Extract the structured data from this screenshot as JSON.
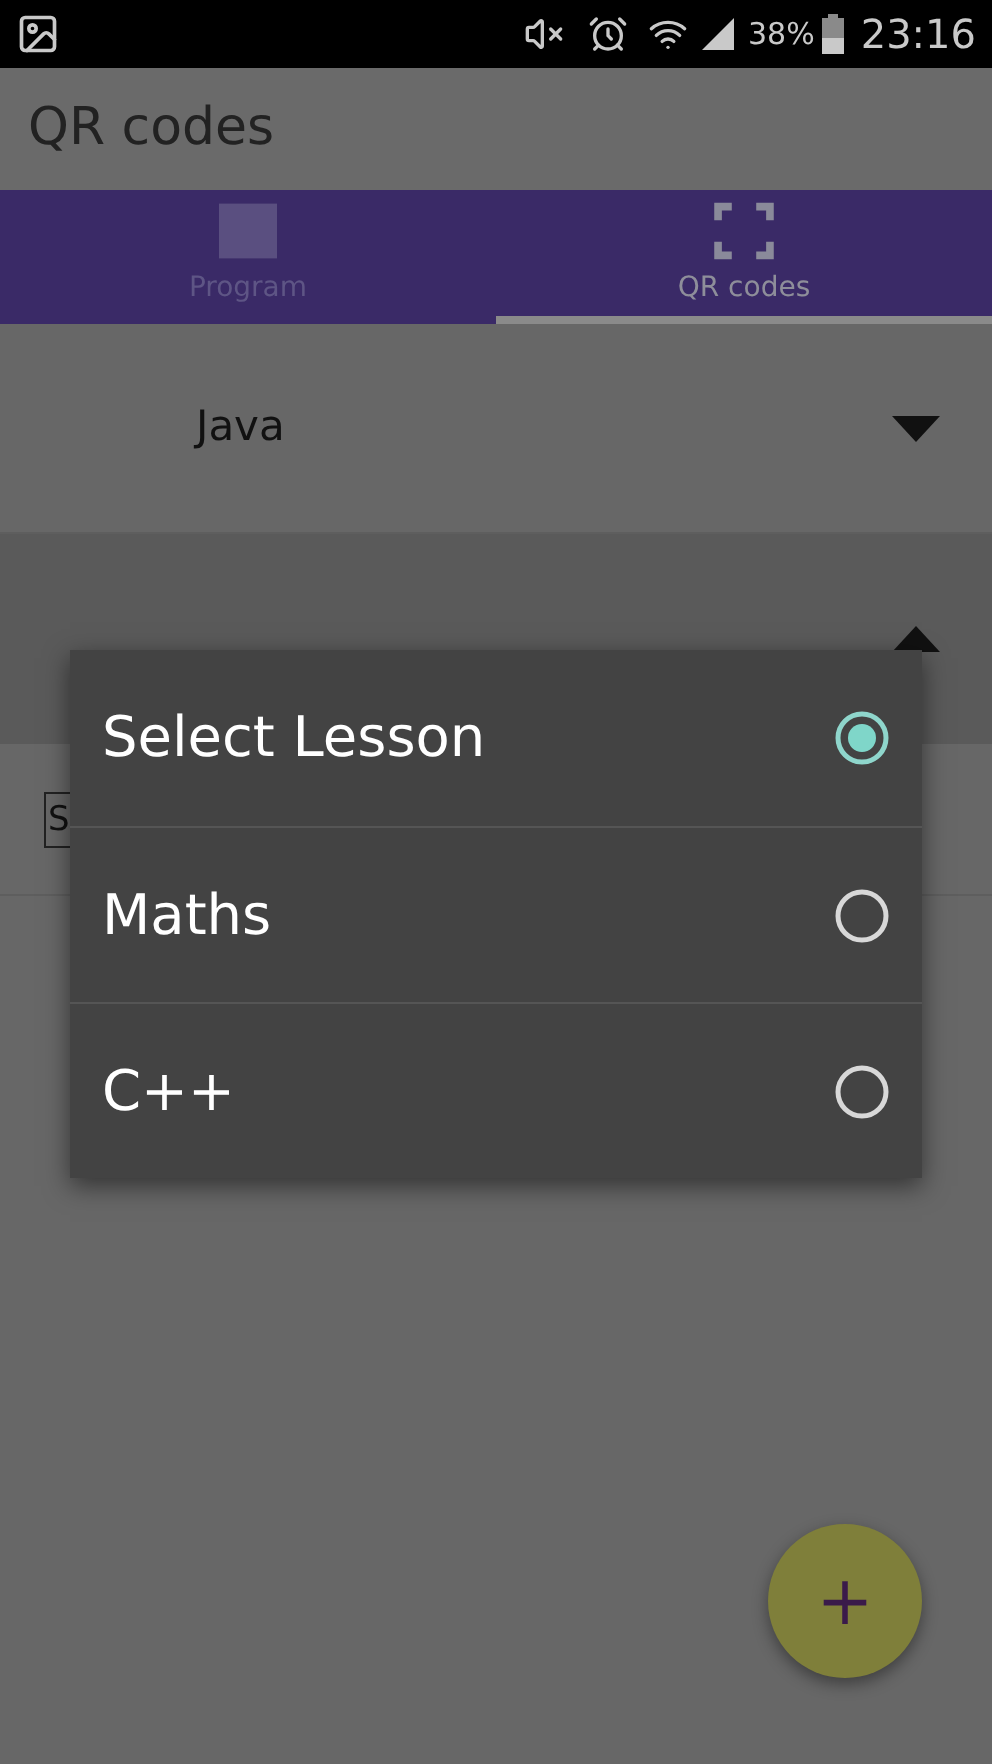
{
  "status_bar": {
    "battery": "38%",
    "time": "23:16"
  },
  "app_bar": {
    "title": "QR codes"
  },
  "tabs": [
    {
      "label": "Program",
      "selected": false,
      "kind": "calendar"
    },
    {
      "label": "QR codes",
      "selected": true,
      "kind": "scan"
    }
  ],
  "spinners": [
    {
      "value": "Java",
      "expanded": false
    },
    {
      "expanded": true
    }
  ],
  "field": {
    "value": "S"
  },
  "dialog": {
    "options": [
      {
        "label": "Select Lesson",
        "selected": true
      },
      {
        "label": "Maths",
        "selected": false
      },
      {
        "label": "C++",
        "selected": false
      }
    ]
  },
  "fab": {
    "label": "+"
  }
}
